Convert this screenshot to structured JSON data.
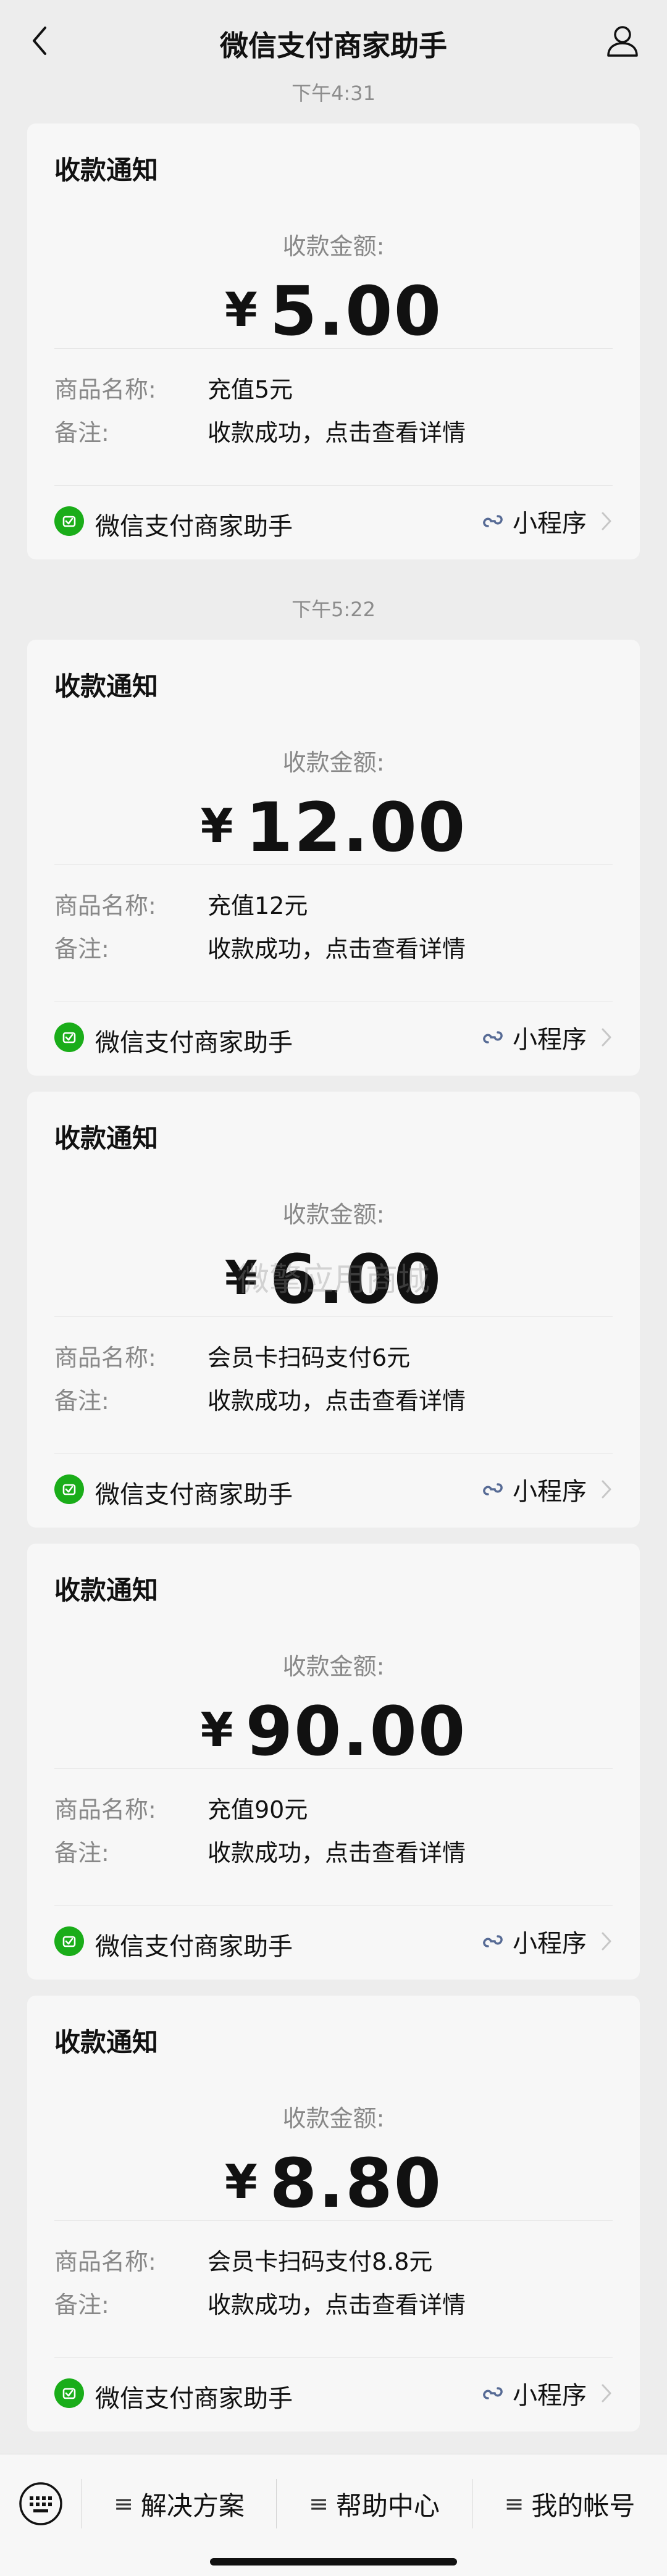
{
  "header": {
    "title": "微信支付商家助手"
  },
  "timestamps": [
    "下午4:31",
    "下午5:22"
  ],
  "cards": [
    {
      "title": "收款通知",
      "amount_label": "收款金额:",
      "currency": "¥",
      "amount": "5.00",
      "rows": [
        {
          "k": "商品名称:",
          "v": "充值5元"
        },
        {
          "k": "备注:",
          "v": "收款成功，点击查看详情"
        }
      ],
      "merchant": "微信支付商家助手",
      "mini_program": "小程序"
    },
    {
      "title": "收款通知",
      "amount_label": "收款金额:",
      "currency": "¥",
      "amount": "12.00",
      "rows": [
        {
          "k": "商品名称:",
          "v": "充值12元"
        },
        {
          "k": "备注:",
          "v": "收款成功，点击查看详情"
        }
      ],
      "merchant": "微信支付商家助手",
      "mini_program": "小程序"
    },
    {
      "title": "收款通知",
      "amount_label": "收款金额:",
      "currency": "¥",
      "amount": "6.00",
      "rows": [
        {
          "k": "商品名称:",
          "v": "会员卡扫码支付6元"
        },
        {
          "k": "备注:",
          "v": "收款成功，点击查看详情"
        }
      ],
      "merchant": "微信支付商家助手",
      "mini_program": "小程序"
    },
    {
      "title": "收款通知",
      "amount_label": "收款金额:",
      "currency": "¥",
      "amount": "90.00",
      "rows": [
        {
          "k": "商品名称:",
          "v": "充值90元"
        },
        {
          "k": "备注:",
          "v": "收款成功，点击查看详情"
        }
      ],
      "merchant": "微信支付商家助手",
      "mini_program": "小程序"
    },
    {
      "title": "收款通知",
      "amount_label": "收款金额:",
      "currency": "¥",
      "amount": "8.80",
      "rows": [
        {
          "k": "商品名称:",
          "v": "会员卡扫码支付8.8元"
        },
        {
          "k": "备注:",
          "v": "收款成功，点击查看详情"
        }
      ],
      "merchant": "微信支付商家助手",
      "mini_program": "小程序"
    }
  ],
  "watermark": "微擎应用商城",
  "menu": {
    "items": [
      "解决方案",
      "帮助中心",
      "我的帐号"
    ]
  },
  "colors": {
    "background": "#ededed",
    "card": "#f7f7f7",
    "brand_green": "#1aad19",
    "mini_program_blue": "#576b95"
  },
  "icons": {
    "back": "chevron-left-icon",
    "profile": "person-icon",
    "merchant": "wechat-pay-merchant-icon",
    "mini_program": "mini-program-link-icon",
    "keyboard": "keyboard-icon",
    "menu": "hamburger-icon"
  }
}
